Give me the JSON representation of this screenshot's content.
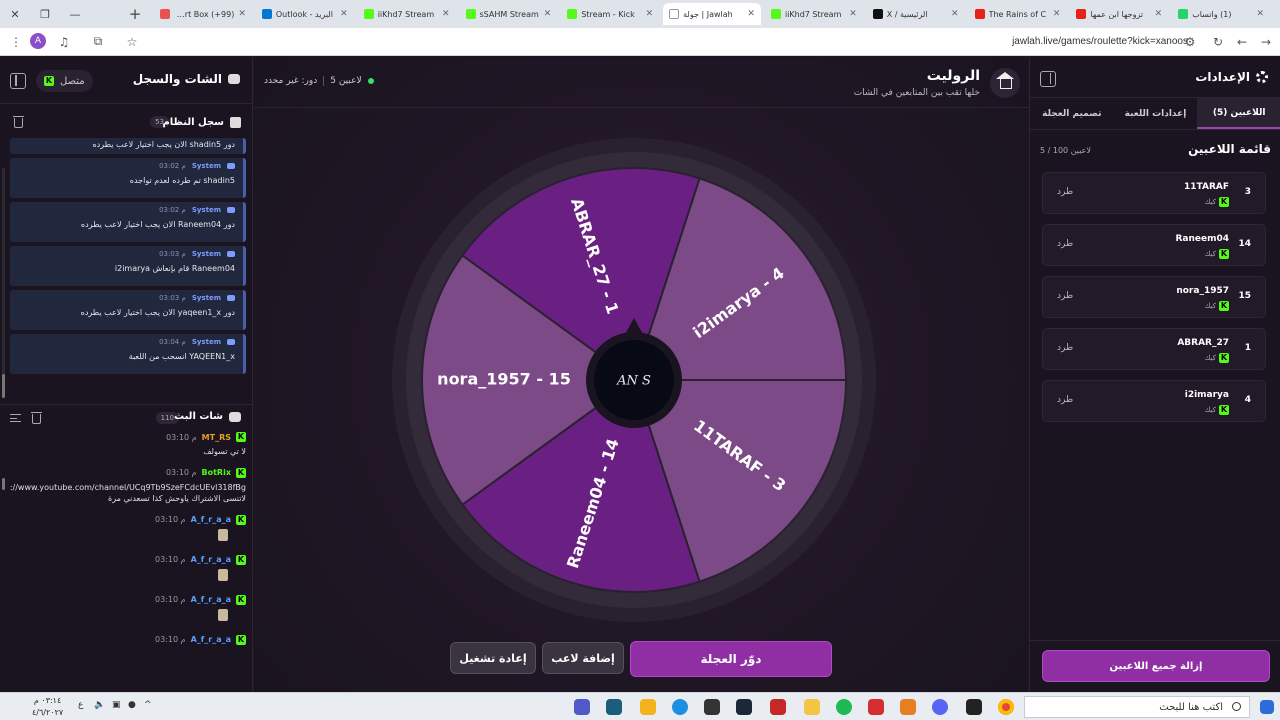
{
  "browser": {
    "tabs": [
      {
        "title": "(1) واتساب",
        "color": "#25d366"
      },
      {
        "title": "تزوجها ابن عمها",
        "color": "#e62117"
      },
      {
        "title": "The Rains of C",
        "color": "#e62117"
      },
      {
        "title": "الرئيسية / X",
        "color": "#111111"
      },
      {
        "title": "iiKhd7 Stream",
        "color": "#53fc18"
      },
      {
        "title": "Jawlah | جولة",
        "color": "#ffffff",
        "active": true
      },
      {
        "title": "Stream - Kick",
        "color": "#53fc18"
      },
      {
        "title": "sSAHM Stream",
        "color": "#53fc18"
      },
      {
        "title": "iiKhd7 Stream",
        "color": "#53fc18"
      },
      {
        "title": "البريد - Outlook",
        "color": "#0078d4"
      },
      {
        "title": "(99+) Alert Box",
        "color": "#e9534f"
      }
    ],
    "url": "jawlah.live/games/roulette?kick=xanoos",
    "profile_initial": "A"
  },
  "chat_panel": {
    "title": "الشات والسجل",
    "status": "متصل",
    "system_log": {
      "title": "سجل النظام",
      "count": "53",
      "first_partial": "دور shadin5 الان يجب اختيار لاعب يطرده",
      "items": [
        {
          "who": "System",
          "time": "03:02 م",
          "msg": "shadin5 تم طرده لعدم تواجده"
        },
        {
          "who": "System",
          "time": "03:02 م",
          "msg": "دور Raneem04 الان يجب اختيار لاعب يطرده"
        },
        {
          "who": "System",
          "time": "03:03 م",
          "msg": "Raneem04 قام بإنعاش i2imarya"
        },
        {
          "who": "System",
          "time": "03:03 م",
          "msg": "دور yaqeen1_x الان يجب اختيار لاعب يطرده"
        },
        {
          "who": "System",
          "time": "03:04 م",
          "msg": "YAQEEN1_x انسحب من اللعبة"
        }
      ]
    },
    "broadcast": {
      "title": "شات البث",
      "count": "110",
      "items": [
        {
          "user": "MT_RS",
          "time": "03:10 م",
          "color": "#e0a020",
          "msg": "لا تي تسولف"
        },
        {
          "user": "BotRix",
          "time": "03:10 م",
          "color": "#53fc18",
          "msg": "https://www.youtube.com/channel/UCq9Tb9SzeFCdcUEvl318fBg لاتنسى الاشتراك ياوحش كذا تسعدني مرة"
        },
        {
          "user": "A_f_r_a_a",
          "time": "03:10 م",
          "color": "#5aa0ff",
          "emote": true
        },
        {
          "user": "A_f_r_a_a",
          "time": "03:10 م",
          "color": "#5aa0ff",
          "emote": true
        },
        {
          "user": "A_f_r_a_a",
          "time": "03:10 م",
          "color": "#5aa0ff",
          "emote": true
        },
        {
          "user": "A_f_r_a_a",
          "time": "03:10 م",
          "color": "#5aa0ff",
          "emote": false
        }
      ]
    }
  },
  "game": {
    "title": "الروليت",
    "subtitle": "خلها تقب بين المتابعين في الشات",
    "players_count": "5 لاعبين",
    "turn": "دور: غير محدد",
    "center_logo": "AN S",
    "segments": [
      {
        "label": "i2imarya - 4",
        "color": "#7c4a86"
      },
      {
        "label": "11TARAF - 3",
        "color": "#7c4a86"
      },
      {
        "label": "Raneem04 - 14",
        "color": "#6a2083"
      },
      {
        "label": "nora_1957 - 15",
        "color": "#7c4a86"
      },
      {
        "label": "ABRAR_27 - 1",
        "color": "#6a2083"
      }
    ],
    "buttons": {
      "spin": "دوّر العجلة",
      "add": "إضافة لاعب",
      "restart": "إعادة تشغيل"
    }
  },
  "settings": {
    "title": "الإعدادات",
    "tabs": [
      "اللاعبين (5)",
      "إعدادات اللعبة",
      "تصميم العجلة"
    ],
    "players_title": "قائمة اللاعبين",
    "players_count": "5 / 100 لاعبين",
    "kick_label": "طرد",
    "platform": "كيك",
    "players": [
      {
        "name": "11TARAF",
        "num": "3"
      },
      {
        "name": "Raneem04",
        "num": "14"
      },
      {
        "name": "nora_1957",
        "num": "15"
      },
      {
        "name": "ABRAR_27",
        "num": "1"
      },
      {
        "name": "i2imarya",
        "num": "4"
      }
    ],
    "clear_all": "إزالة جميع اللاعبين"
  },
  "taskbar": {
    "search_placeholder": "اكتب هنا للبحث",
    "time": "٠٣:١٤ م",
    "date": "٤/٦/٢٠٢٧",
    "lang": "ع"
  }
}
